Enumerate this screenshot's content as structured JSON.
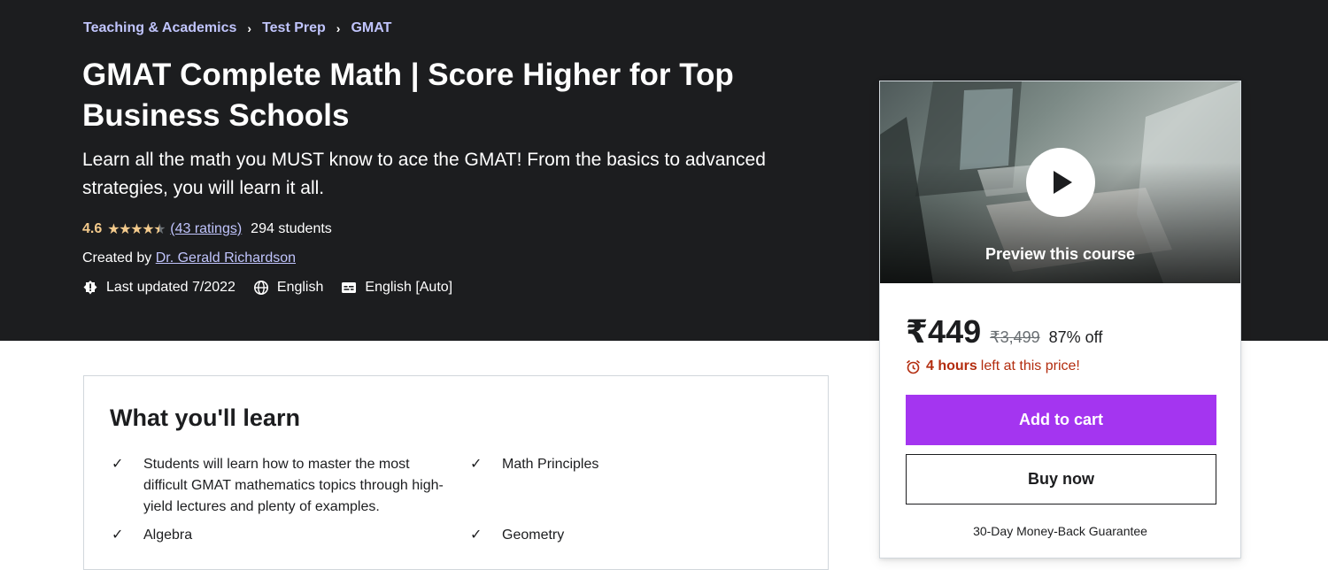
{
  "breadcrumb": [
    "Teaching & Academics",
    "Test Prep",
    "GMAT"
  ],
  "course": {
    "title": "GMAT Complete Math | Score Higher for Top Business Schools",
    "subtitle": "Learn all the math you MUST know to ace the GMAT! From the basics to advanced strategies, you will learn it all.",
    "rating": "4.6",
    "ratings_count": "(43 ratings)",
    "students": "294 students",
    "created_by_label": "Created by",
    "instructor": "Dr. Gerald Richardson",
    "last_updated": "Last updated 7/2022",
    "language": "English",
    "captions": "English [Auto]"
  },
  "card": {
    "preview_label": "Preview this course",
    "price": "₹449",
    "original_price": "₹3,499",
    "discount": "87% off",
    "timer_bold": "4 hours",
    "timer_rest": "left at this price!",
    "add_to_cart": "Add to cart",
    "buy_now": "Buy now",
    "guarantee": "30-Day Money-Back Guarantee"
  },
  "learn": {
    "title": "What you'll learn",
    "items": [
      "Students will learn how to master the most difficult GMAT mathematics topics through high-yield lectures and plenty of examples.",
      "Math Principles",
      "Algebra",
      "Geometry"
    ]
  },
  "colors": {
    "hero_bg": "#1c1d1f",
    "link": "#c0c4fc",
    "star": "#f3ca8c",
    "cta_purple": "#a435f0",
    "timer_red": "#b32d0f"
  },
  "icons": [
    "chevron-right-icon",
    "star-icon",
    "alert-badge-icon",
    "globe-icon",
    "closed-captions-icon",
    "play-icon",
    "alarm-clock-icon",
    "check-icon"
  ]
}
